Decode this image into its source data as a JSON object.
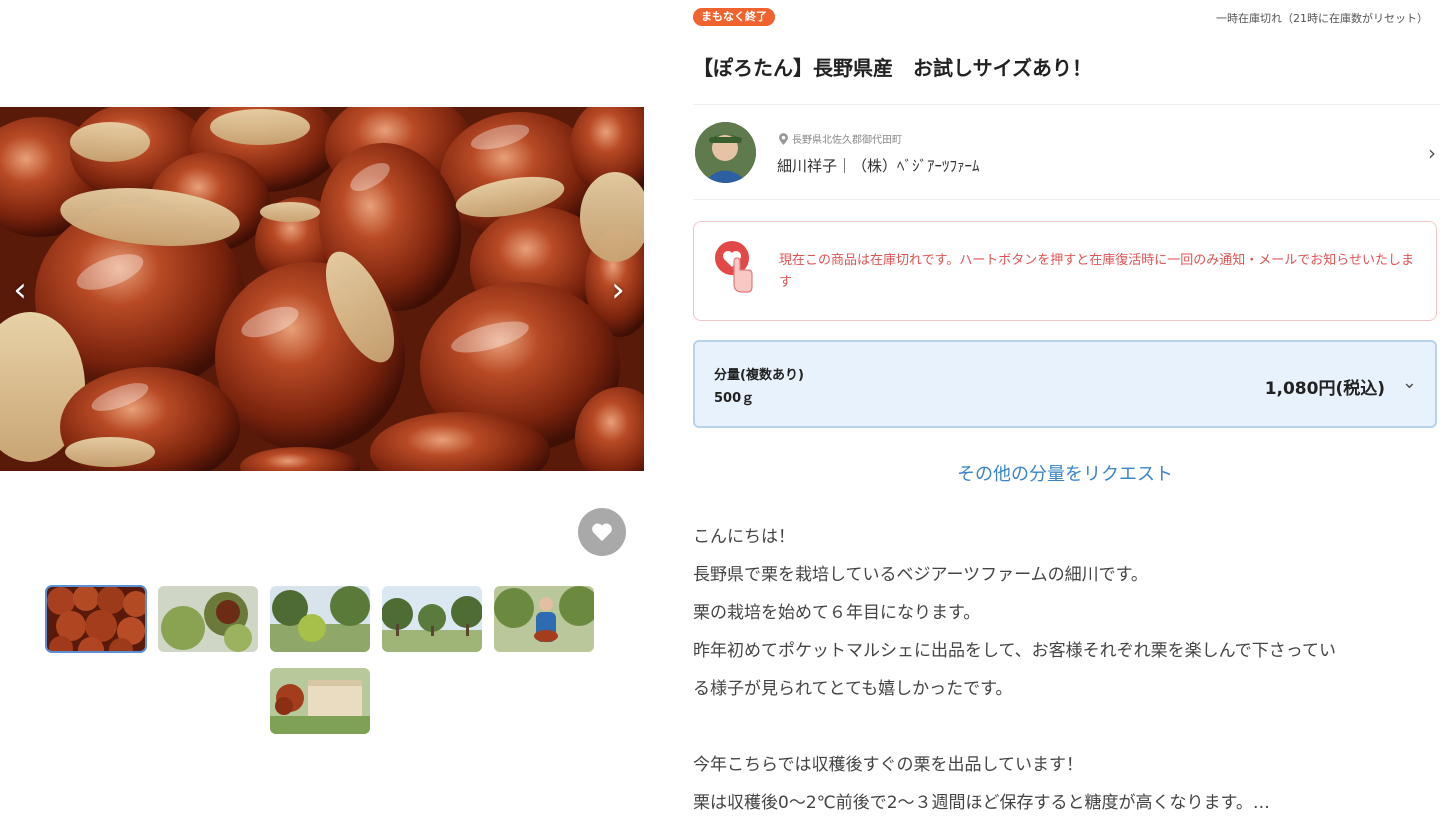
{
  "gallery": {
    "prev_icon": "chevron-left-icon",
    "next_icon": "chevron-right-icon",
    "favorite_icon": "heart-icon",
    "thumbnails": [
      "chestnuts",
      "chestnut-burs",
      "chestnut-bur-tree",
      "chestnut-orchard",
      "farmer-with-chestnuts",
      "gift-box"
    ]
  },
  "badge": "まもなく終了",
  "stock_note": "一時在庫切れ（21時に在庫数がリセット）",
  "title": "【ぽろたん】長野県産　お試しサイズあり！",
  "producer": {
    "location": "長野県北佐久郡御代田町",
    "name": "細川祥子｜（株）ﾍﾞｼﾞｱｰﾂﾌｧｰﾑ",
    "location_icon": "map-pin-icon",
    "chevron_icon": "chevron-right-icon"
  },
  "notice": {
    "icon": "heart-tap-icon",
    "text": "現在この商品は在庫切れです。ハートボタンを押すと在庫復活時に一回のみ通知・メールでお知らせいたします"
  },
  "variant": {
    "label": "分量(複数あり)",
    "value": "500ｇ",
    "price": "1,080円(税込)"
  },
  "request_link": "その他の分量をリクエスト",
  "description": [
    "こんにちは！",
    "長野県で栗を栽培しているベジアーツファームの細川です。",
    "栗の栽培を始めて６年目になります。",
    "昨年初めてポケットマルシェに出品をして、お客様それぞれ栗を楽しんで下さってい",
    "る様子が見られてとても嬉しかったです。",
    "",
    "今年こちらでは収穫後すぐの栗を出品しています！",
    "栗は収穫後0〜2℃前後で2〜３週間ほど保存すると糖度が高くなります。…"
  ],
  "colors": {
    "badge": "#f0622e",
    "notice_text": "#e05353",
    "variant_bg": "#e8f2fc",
    "link": "#3a84c9"
  }
}
